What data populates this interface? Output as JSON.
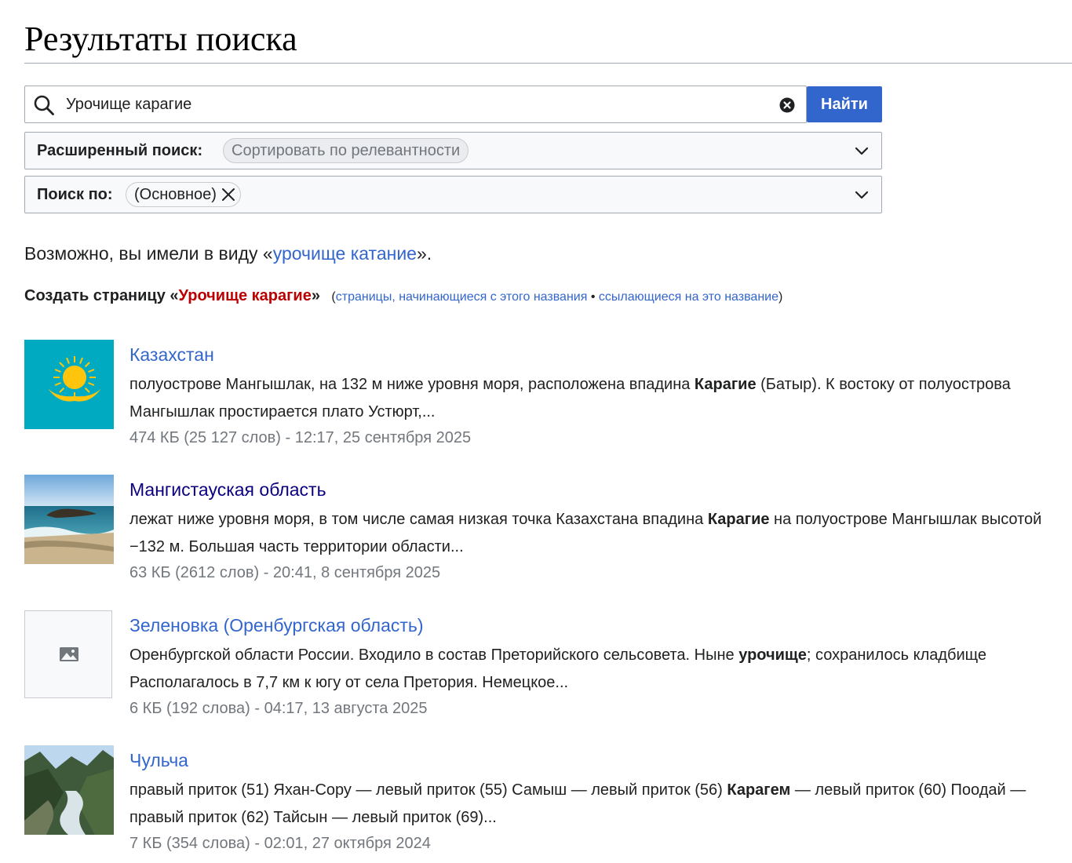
{
  "page_title": "Результаты поиска",
  "search": {
    "value": "Урочище карагие",
    "button_label": "Найти"
  },
  "advanced": {
    "label": "Расширенный поиск:",
    "chip": "Сортировать по релевантности"
  },
  "namespace": {
    "label": "Поиск по:",
    "chip": "(Основное)"
  },
  "suggestion": {
    "prefix": "Возможно, вы имели в виду «",
    "link": "урочище катание",
    "suffix": "»."
  },
  "create": {
    "prefix": "Создать страницу «",
    "page": "Урочище карагие",
    "suffix": "»",
    "open_paren": "(",
    "link_prefix": "страницы, начинающиеся с этого названия",
    "separator": " • ",
    "link_links": "ссылающиеся на это название",
    "close_paren": ")"
  },
  "results": [
    {
      "title": "Казахстан",
      "thumb": "kazakhstan-flag-icon",
      "snippet": [
        "полуострове Мангышлак, на 132 м ниже уровня моря, расположена впадина ",
        "Карагие",
        " (Батыр). К востоку от полуострова Мангышлак простирается плато Устюрт,..."
      ],
      "meta": "474 КБ (25 127 слов) - 12:17, 25 сентября 2025"
    },
    {
      "title": "Мангистауская область",
      "thumb": "sea-coast-photo",
      "snippet": [
        "лежат ниже уровня моря, в том числе самая низкая точка Казахстана впадина ",
        "Карагие",
        " на полуострове Мангышлак высотой −132 м. Большая часть территории области..."
      ],
      "meta": "63 КБ (2612 слов) - 20:41, 8 сентября 2025"
    },
    {
      "title": "Зеленовка (Оренбургская область)",
      "thumb": "image-placeholder-icon",
      "snippet": [
        "Оренбургской области России. Входило в состав Преторийского сельсовета. Ныне ",
        "урочище",
        "; сохранилось кладбище Располагалось в 7,7 км к югу от села Претория. Немецкое..."
      ],
      "meta": "6 КБ (192 слова) - 04:17, 13 августа 2025"
    },
    {
      "title": "Чульча",
      "thumb": "mountain-river-photo",
      "snippet": [
        "правый приток (51) Яхан-Сору — левый приток (55) Самыш — левый приток (56) ",
        "Карагем",
        " — левый приток (60) Поодай — правый приток (62) Тайсын — левый приток (69)..."
      ],
      "meta": "7 КБ (354 слова) - 02:01, 27 октября 2024"
    }
  ],
  "colors": {
    "link": "#3366cc",
    "visited_link": "#0b0080",
    "red_link": "#ba0000",
    "button": "#3366cc",
    "meta_text": "#72777d"
  }
}
